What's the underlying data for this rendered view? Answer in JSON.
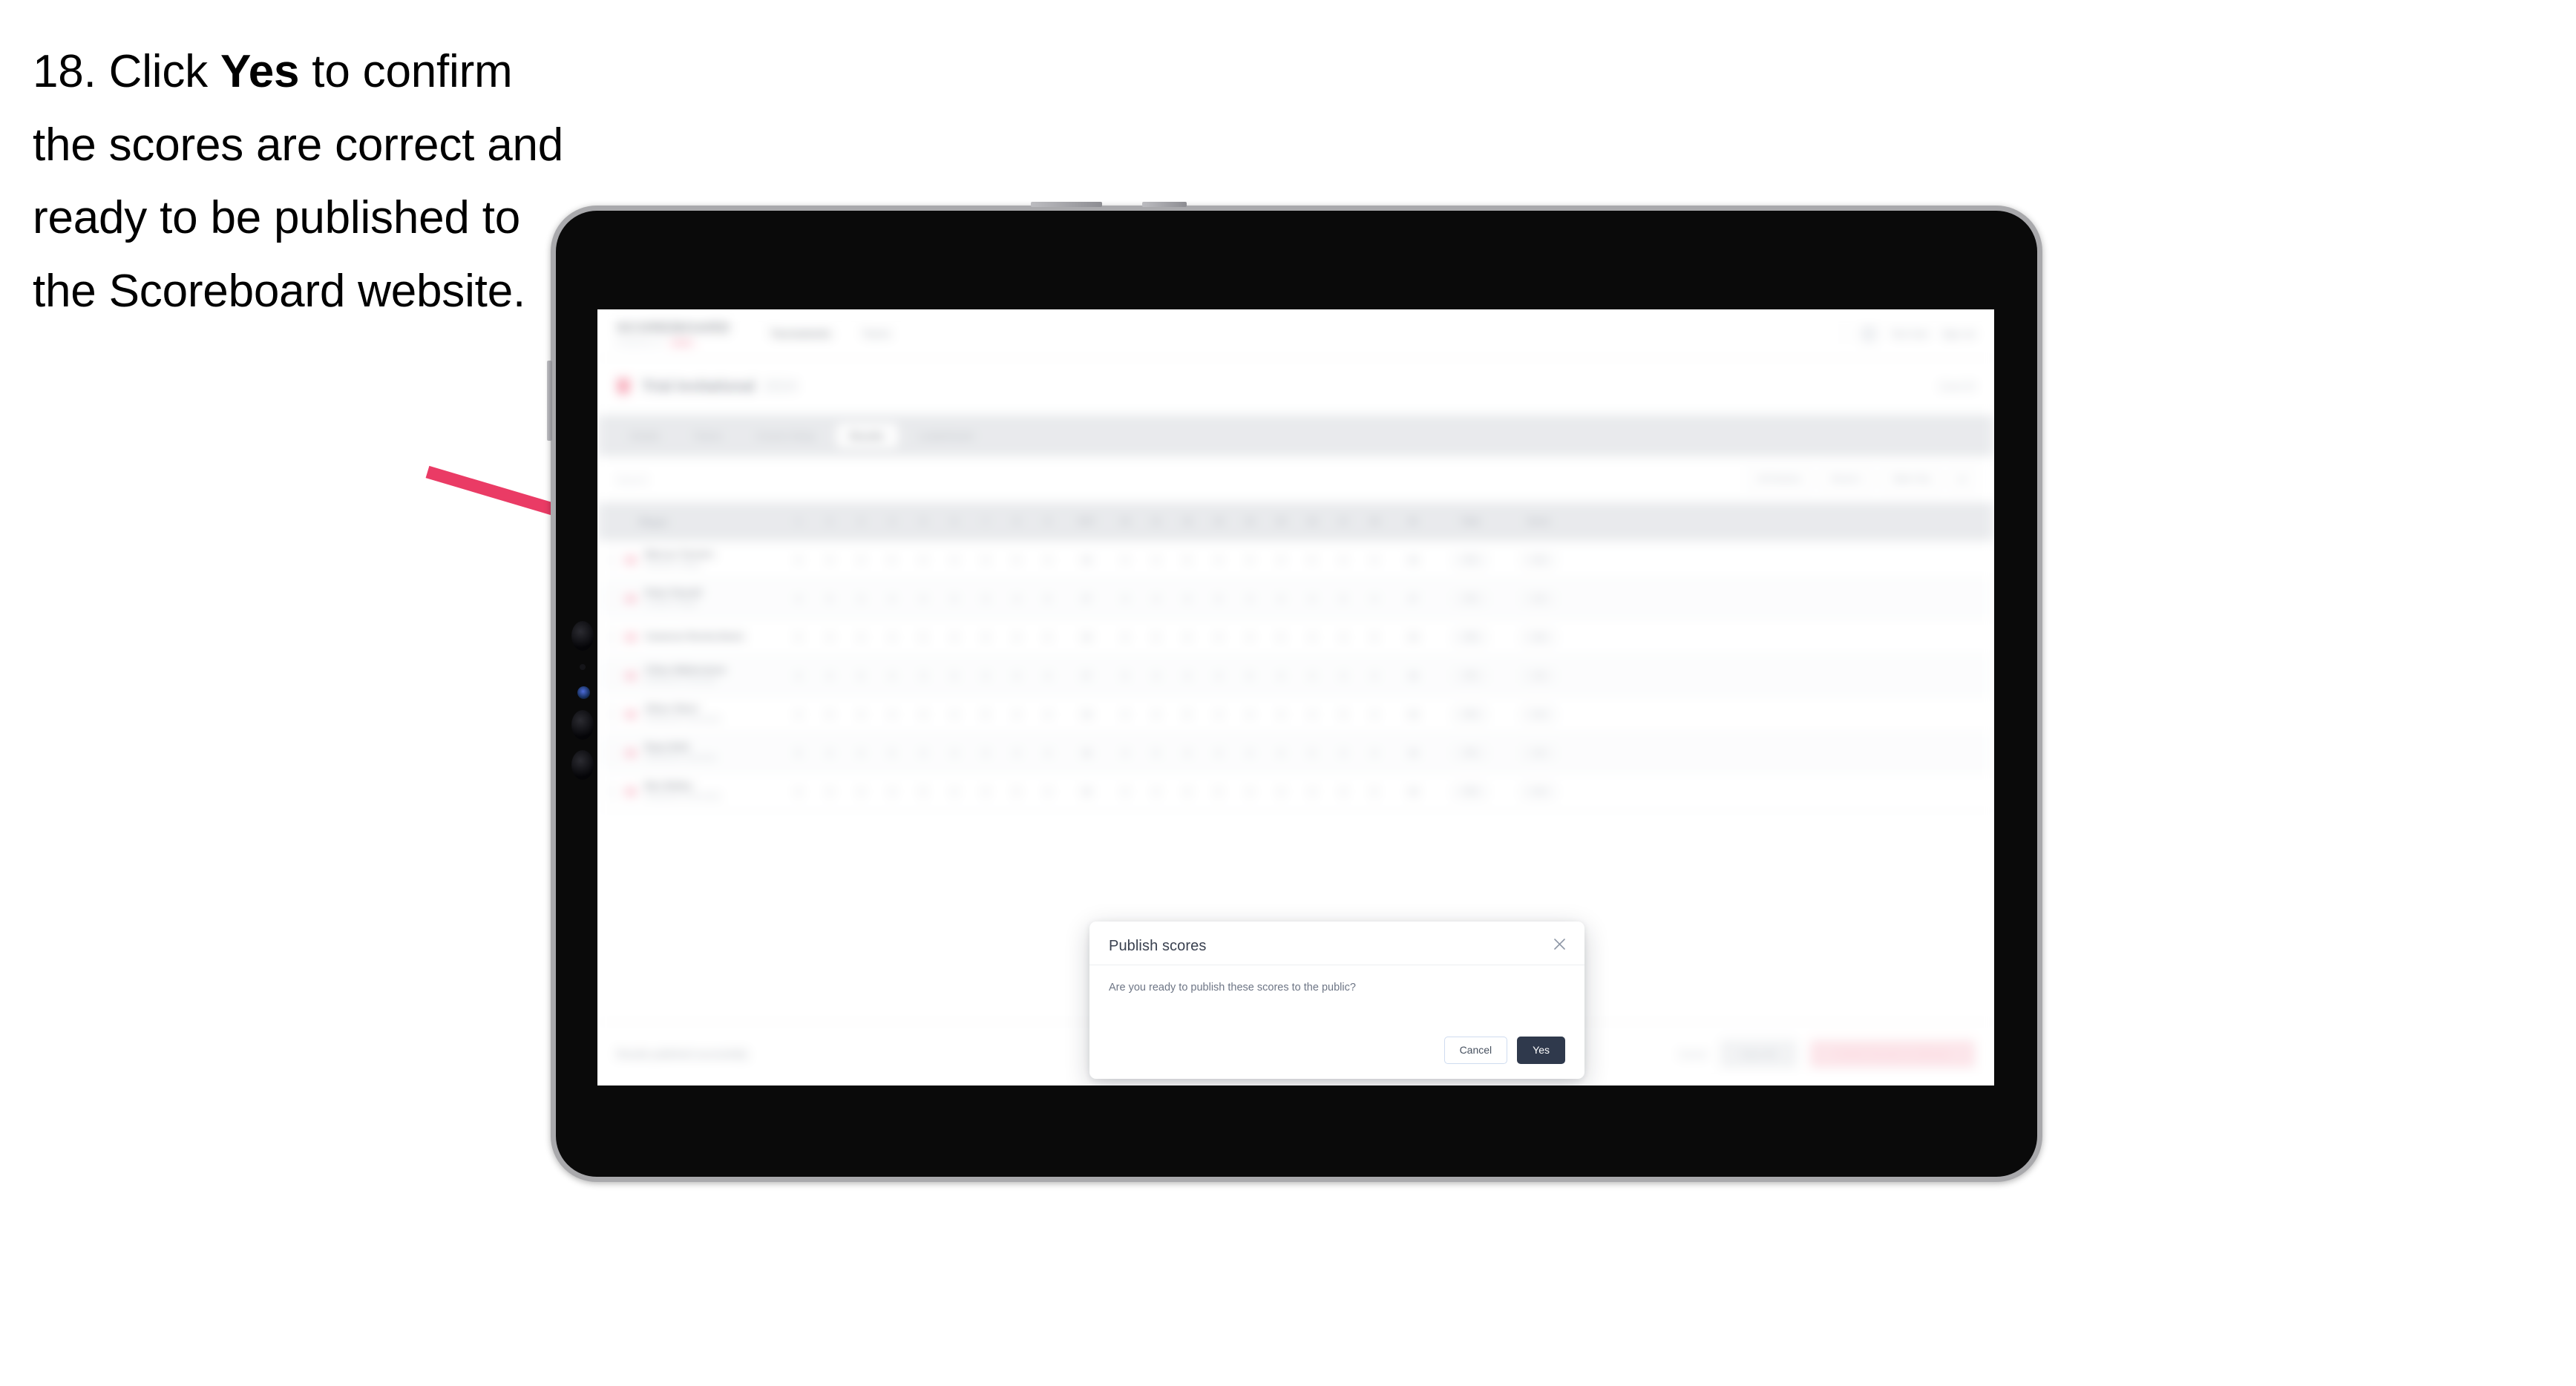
{
  "instruction": {
    "number": "18.",
    "before": "Click ",
    "emphasis": "Yes",
    "after": " to confirm the scores are correct and ready to be published to the Scoreboard website."
  },
  "annotation": {
    "arrow_color": "#ea3b65",
    "arrow_name": "pointer-arrow"
  },
  "device": {
    "frame_color": "#a9a9ac",
    "bezel_color": "#0a0a0a",
    "type": "tablet"
  },
  "app": {
    "brand": {
      "word": "SCOREBOARD",
      "sub": "POWERED BY",
      "pill": "GOLF"
    },
    "nav": [
      {
        "label": "Tournaments",
        "active": true
      },
      {
        "label": "Teams",
        "active": false
      }
    ],
    "header_right": {
      "user": "Test User",
      "signout": "Sign out"
    },
    "event": {
      "title": "Trial Invitational",
      "year": "2024",
      "right_label": "Event ID"
    },
    "tabs": [
      {
        "label": "Details",
        "active": false
      },
      {
        "label": "Teams",
        "active": false
      },
      {
        "label": "Course Setup",
        "active": false
      },
      {
        "label": "Results",
        "active": true
      },
      {
        "label": "Leaderboard",
        "active": false
      }
    ],
    "filters": {
      "search_placeholder": "Search",
      "controls": [
        {
          "label": "All Divisions"
        },
        {
          "label": "Round 1"
        },
        {
          "label": "Table Only"
        },
        {
          "label": "⚙"
        }
      ]
    },
    "table": {
      "columns": [
        "Player",
        "1",
        "2",
        "3",
        "4",
        "5",
        "6",
        "7",
        "8",
        "9",
        "OUT",
        "10",
        "11",
        "12",
        "13",
        "14",
        "15",
        "16",
        "17",
        "18",
        "IN",
        "Total",
        "Score"
      ],
      "rows": [
        {
          "name": "Marcus Turners",
          "sub": "Eastside College",
          "scores": [
            "4",
            "4",
            "3",
            "5",
            "4",
            "4",
            "3",
            "5",
            "4",
            "36",
            "4",
            "3",
            "5",
            "4",
            "4",
            "3",
            "5",
            "4",
            "4",
            "36",
            "72",
            "+0"
          ]
        },
        {
          "name": "Peter Parnell",
          "sub": "Coastal College",
          "scores": [
            "4",
            "5",
            "3",
            "4",
            "4",
            "5",
            "3",
            "4",
            "5",
            "37",
            "4",
            "4",
            "4",
            "5",
            "3",
            "4",
            "4",
            "5",
            "4",
            "37",
            "74",
            "+2"
          ]
        },
        {
          "name": "Cameron Rocha-Davis",
          "sub": "",
          "scores": [
            "5",
            "4",
            "4",
            "4",
            "5",
            "4",
            "4",
            "4",
            "5",
            "39",
            "4",
            "5",
            "4",
            "4",
            "4",
            "5",
            "4",
            "4",
            "5",
            "39",
            "78",
            "+6"
          ]
        },
        {
          "name": "Chloe Walterstone",
          "sub": "Northshore University",
          "scores": [
            "4",
            "4",
            "5",
            "4",
            "3",
            "5",
            "4",
            "4",
            "4",
            "37",
            "5",
            "4",
            "4",
            "4",
            "5",
            "4",
            "4",
            "4",
            "4",
            "38",
            "75",
            "+3"
          ]
        },
        {
          "name": "Oliver Short",
          "sub": "Westbrook Community",
          "scores": [
            "4",
            "5",
            "4",
            "4",
            "4",
            "4",
            "5",
            "4",
            "4",
            "38",
            "4",
            "4",
            "5",
            "4",
            "4",
            "4",
            "4",
            "5",
            "4",
            "38",
            "76",
            "+4"
          ]
        },
        {
          "name": "Ryan Britt",
          "sub": "Northshore University",
          "scores": [
            "5",
            "4",
            "4",
            "5",
            "4",
            "4",
            "4",
            "4",
            "4",
            "38",
            "4",
            "5",
            "4",
            "4",
            "4",
            "4",
            "5",
            "4",
            "4",
            "38",
            "76",
            "+4"
          ]
        },
        {
          "name": "Ben Bailey",
          "sub": "Westbrook Community",
          "scores": [
            "4",
            "4",
            "4",
            "4",
            "5",
            "4",
            "4",
            "5",
            "4",
            "38",
            "4",
            "4",
            "4",
            "5",
            "4",
            "4",
            "4",
            "4",
            "5",
            "38",
            "76",
            "+4"
          ]
        }
      ]
    },
    "action_bar": {
      "left_label": "Results published successfully",
      "link": "Cancel",
      "secondary_button": "Save All",
      "primary_button": "Publish Results to Website"
    }
  },
  "modal": {
    "title": "Publish scores",
    "message": "Are you ready to publish these scores to the public?",
    "cancel_label": "Cancel",
    "confirm_label": "Yes",
    "close_icon": "✕",
    "confirm_color": "#2f394c"
  }
}
